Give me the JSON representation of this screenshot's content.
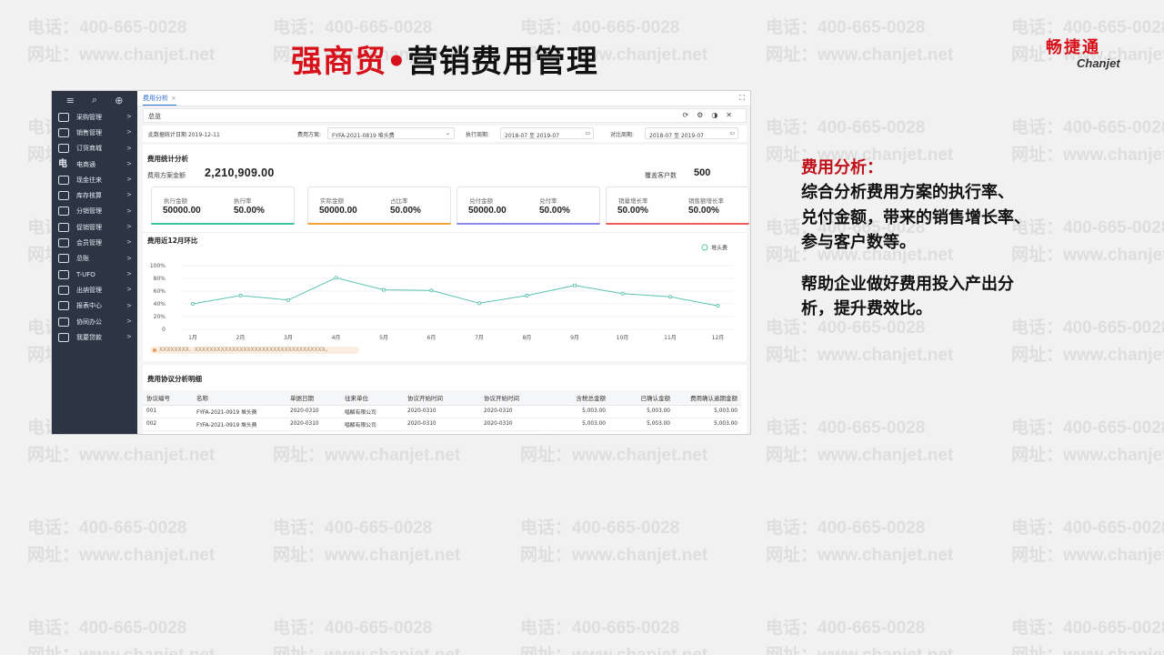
{
  "watermark": {
    "phone": "电话：400-665-0028",
    "site": "网址：www.chanjet.net"
  },
  "slide": {
    "title_brand": "强商贸",
    "title_sep": "•",
    "title_rest": "营销费用管理"
  },
  "logo": {
    "cn": "畅捷通",
    "en": "Chanjet"
  },
  "sidebar": {
    "items": [
      {
        "label": "采购管理",
        "icon": "cart-icon"
      },
      {
        "label": "销售管理",
        "icon": "sales-icon"
      },
      {
        "label": "订货商城",
        "icon": "store-icon"
      },
      {
        "label": "电商通",
        "icon": "ecommerce-icon",
        "glyph": "电"
      },
      {
        "label": "现金往来",
        "icon": "cash-icon"
      },
      {
        "label": "库存核算",
        "icon": "warehouse-icon"
      },
      {
        "label": "分销管理",
        "icon": "distribution-icon"
      },
      {
        "label": "促销管理",
        "icon": "promotion-icon"
      },
      {
        "label": "会员管理",
        "icon": "member-icon"
      },
      {
        "label": "总账",
        "icon": "ledger-icon"
      },
      {
        "label": "T-UFO",
        "icon": "report-icon"
      },
      {
        "label": "出纳管理",
        "icon": "cashier-icon"
      },
      {
        "label": "报表中心",
        "icon": "chart-icon"
      },
      {
        "label": "协同办公",
        "icon": "collaboration-icon"
      },
      {
        "label": "我要贷款",
        "icon": "loan-icon"
      }
    ]
  },
  "tab": {
    "label": "费用分析",
    "close": "×"
  },
  "overview": {
    "label": "总览",
    "tools": "⟳⚙◑✕"
  },
  "filter": {
    "date_label": "此数据统计日期 2019-12-11",
    "plan_label": "费用方案:",
    "plan_value": "FYFA-2021-0819 堆头费",
    "exec_label": "执行周期:",
    "exec_value": "2018-07 至 2019-07",
    "compare_label": "对比周期:",
    "compare_value": "2018-07 至 2019-07"
  },
  "stats": {
    "title": "费用统计分析",
    "total_label": "费用方案金额",
    "total_value": "2,210,909.00",
    "cust_label": "覆盖客户数",
    "cust_value": "500",
    "kpis": [
      {
        "l1": "执行金额",
        "v1": "50000.00",
        "l2": "执行率",
        "v2": "50.00%",
        "color": "#3fc1a4"
      },
      {
        "l1": "实际金额",
        "v1": "50000.00",
        "l2": "占比率",
        "v2": "50.00%",
        "color": "#f3a43b"
      },
      {
        "l1": "兑付金额",
        "v1": "50000.00",
        "l2": "兑付率",
        "v2": "50.00%",
        "color": "#8e86e6"
      },
      {
        "l1": "销量增长率",
        "v1": "50.00%",
        "l2": "销售额增长率",
        "v2": "50.00%",
        "color": "#ef5a5a"
      }
    ]
  },
  "chart_data": {
    "type": "line",
    "title": "费用近12月环比",
    "categories": [
      "1月",
      "2月",
      "3月",
      "4月",
      "5月",
      "6月",
      "7月",
      "8月",
      "9月",
      "10月",
      "11月",
      "12月"
    ],
    "series": [
      {
        "name": "堆头费",
        "values": [
          40,
          53,
          46,
          81,
          62,
          61,
          41,
          53,
          69,
          56,
          51,
          37
        ],
        "color": "#5cc3b0"
      }
    ],
    "yticks": [
      "0",
      "20%",
      "40%",
      "60%",
      "80%",
      "100%"
    ],
    "ylim": [
      0,
      100
    ],
    "grid": true,
    "legend": "top-right",
    "note": "XXXXXXXX、XXXXXXXXXXXXXXXXXXXXXXXXXXXXXXXXXXX。"
  },
  "table": {
    "title": "费用协议分析明细",
    "headers": [
      "协议编号",
      "名称",
      "单据日期",
      "往来单位",
      "协议开始时间",
      "协议开始时间",
      "含税总金额",
      "已确认金额",
      "费用确认逾期金额"
    ],
    "rows": [
      [
        "001",
        "FYFA-2021-0919 堆头费",
        "2020-0310",
        "唱解有限公司",
        "2020-0310",
        "2020-0310",
        "5,003.00",
        "5,003.00",
        "5,003.00"
      ],
      [
        "002",
        "FYFA-2021-0919 堆头费",
        "2020-0310",
        "唱解有限公司",
        "2020-0310",
        "2020-0310",
        "5,003.00",
        "5,003.00",
        "5,003.00"
      ]
    ]
  },
  "notes": {
    "heading": "费用分析：",
    "para1": [
      "综合分析费用方案的执行率、",
      "兑付金额，带来的销售增长率、",
      "参与客户数等。"
    ],
    "para2": [
      "帮助企业做好费用投入产出分",
      "析，提升费效比。"
    ]
  }
}
